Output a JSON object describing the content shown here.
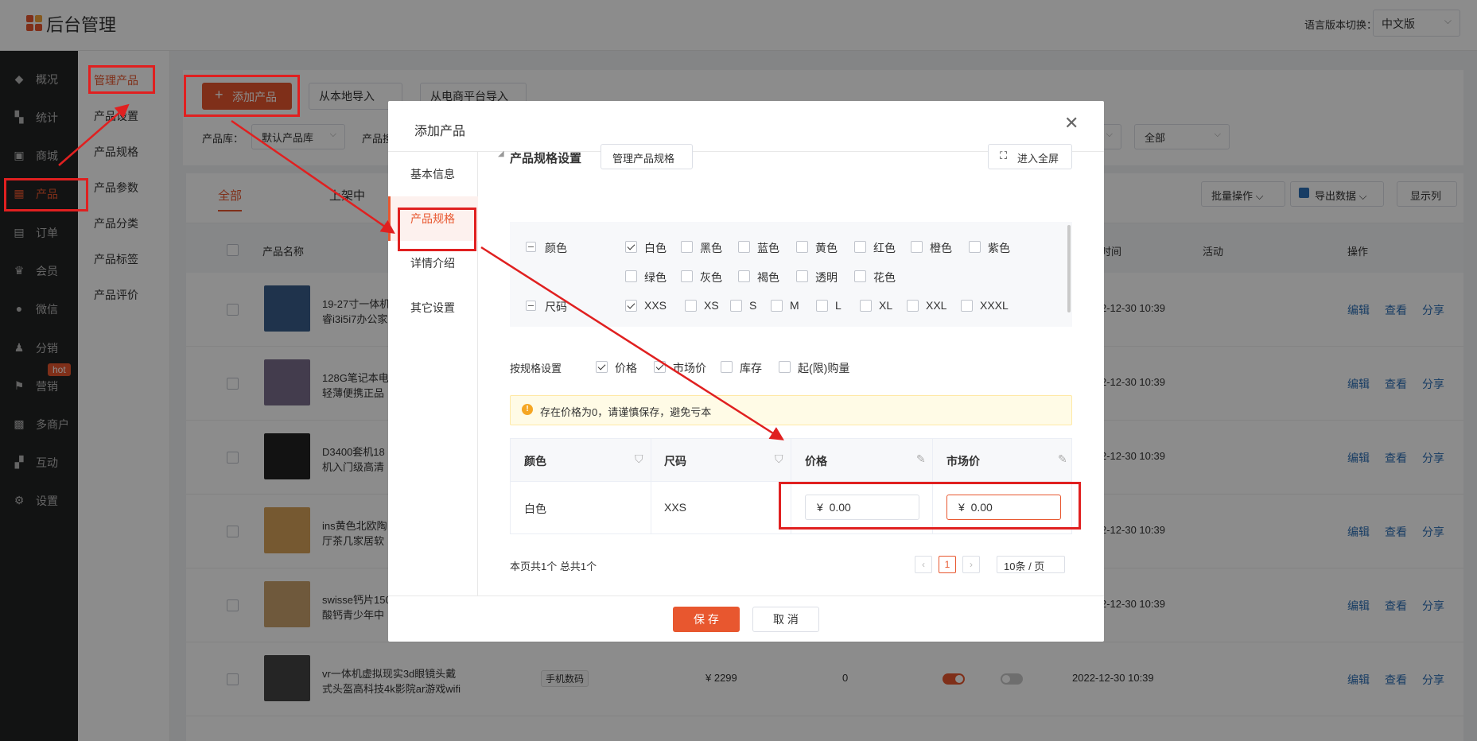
{
  "header": {
    "title": "后台管理",
    "lang_label": "语言版本切换：",
    "lang_value": "中文版"
  },
  "sidebar": {
    "items": [
      {
        "label": "概况",
        "icon": "layers-icon"
      },
      {
        "label": "统计",
        "icon": "chart-icon"
      },
      {
        "label": "商城",
        "icon": "shop-icon"
      },
      {
        "label": "产品",
        "icon": "grid-icon",
        "active": true
      },
      {
        "label": "订单",
        "icon": "order-icon"
      },
      {
        "label": "会员",
        "icon": "crown-icon"
      },
      {
        "label": "微信",
        "icon": "wechat-icon"
      },
      {
        "label": "分销",
        "icon": "share-user-icon"
      },
      {
        "label": "营销",
        "icon": "flag-icon",
        "badge": "hot"
      },
      {
        "label": "多商户",
        "icon": "store-icon"
      },
      {
        "label": "互动",
        "icon": "interact-icon"
      },
      {
        "label": "设置",
        "icon": "gear-icon"
      }
    ]
  },
  "subsidebar": {
    "items": [
      "管理产品",
      "产品设置",
      "产品规格",
      "产品参数",
      "产品分类",
      "产品标签",
      "产品评价"
    ]
  },
  "toolbar": {
    "add_label": "添加产品",
    "import_local": "从本地导入",
    "import_platform": "从电商平台导入",
    "library_label": "产品库：",
    "library_value": "默认产品库",
    "filter2_label": "产品搜",
    "filter_all": "全部"
  },
  "list": {
    "tabs": [
      "全部",
      "上架中"
    ],
    "batch": "批量操作",
    "export": "导出数据",
    "columns_btn": "显示列",
    "headers": {
      "name": "产品名称",
      "time": "时间",
      "activity": "活动",
      "ops": "操作"
    },
    "ops": [
      "编辑",
      "查看",
      "分享"
    ],
    "rows": [
      {
        "name1": "19-27寸一体机",
        "name2": "睿i3i5i7办公家",
        "time": "2-12-30 10:39"
      },
      {
        "name1": "128G笔记本电",
        "name2": "轻薄便携正品",
        "time": "2-12-30 10:39"
      },
      {
        "name1": "D3400套机18",
        "name2": "机入门级高清",
        "time": "2-12-30 10:39"
      },
      {
        "name1": "ins黄色北欧陶",
        "name2": "厅茶几家居软",
        "time": "2-12-30 10:39"
      },
      {
        "name1": "swisse钙片150",
        "name2": "酸钙青少年中",
        "time": "2-12-30 10:39"
      },
      {
        "name1": "vr一体机虚拟现实3d眼镜头戴",
        "name2": "式头盔高科技4k影院ar游戏wifi",
        "tag": "手机数码",
        "price": "¥ 2299",
        "stock": "0",
        "time": "2022-12-30 10:39"
      }
    ]
  },
  "modal": {
    "title": "添加产品",
    "nav": [
      "基本信息",
      "产品规格",
      "详情介绍",
      "其它设置"
    ],
    "section_title": "产品规格设置",
    "manage_btn": "管理产品规格",
    "fullscreen_btn": "进入全屏",
    "color_group": "颜色",
    "colors": [
      {
        "label": "白色",
        "checked": true
      },
      {
        "label": "黑色",
        "checked": false
      },
      {
        "label": "蓝色",
        "checked": false
      },
      {
        "label": "黄色",
        "checked": false
      },
      {
        "label": "红色",
        "checked": false
      },
      {
        "label": "橙色",
        "checked": false
      },
      {
        "label": "紫色",
        "checked": false
      },
      {
        "label": "绿色",
        "checked": false
      },
      {
        "label": "灰色",
        "checked": false
      },
      {
        "label": "褐色",
        "checked": false
      },
      {
        "label": "透明",
        "checked": false
      },
      {
        "label": "花色",
        "checked": false
      }
    ],
    "size_group": "尺码",
    "sizes": [
      {
        "label": "XXS",
        "checked": true
      },
      {
        "label": "XS",
        "checked": false
      },
      {
        "label": "S",
        "checked": false
      },
      {
        "label": "M",
        "checked": false
      },
      {
        "label": "L",
        "checked": false
      },
      {
        "label": "XL",
        "checked": false
      },
      {
        "label": "XXL",
        "checked": false
      },
      {
        "label": "XXXL",
        "checked": false
      }
    ],
    "by_spec_label": "按规格设置",
    "by_spec": [
      {
        "label": "价格",
        "checked": true
      },
      {
        "label": "市场价",
        "checked": true
      },
      {
        "label": "库存",
        "checked": false
      },
      {
        "label": "起(限)购量",
        "checked": false
      }
    ],
    "warning": "存在价格为0，请谨慎保存，避免亏本",
    "table_headers": [
      "颜色",
      "尺码",
      "价格",
      "市场价"
    ],
    "row": {
      "color": "白色",
      "size": "XXS",
      "price_prefix": "¥",
      "price": "0.00",
      "market_prefix": "¥",
      "market": "0.00"
    },
    "pagination": {
      "summary": "本页共1个 总共1个",
      "page": "1",
      "per_page": "10条 / 页"
    },
    "save": "保 存",
    "cancel": "取 消"
  },
  "colors": {
    "accent": "#e8572f",
    "sidebar": "#222324",
    "link": "#2d6fb6",
    "annotation": "#e02020"
  }
}
